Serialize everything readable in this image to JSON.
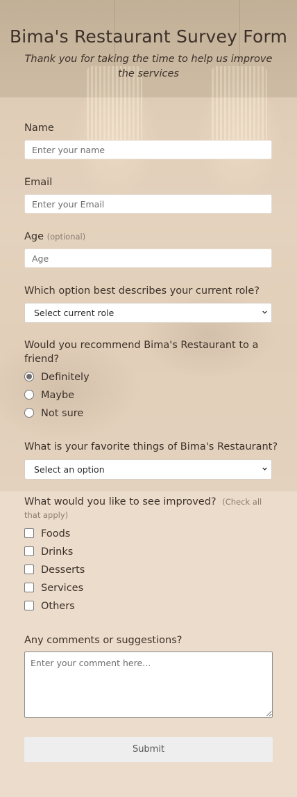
{
  "header": {
    "title": "Bima's Restaurant Survey Form",
    "subtitle": "Thank you for taking the time to help us improve the services"
  },
  "form": {
    "name": {
      "label": "Name",
      "placeholder": "Enter your name"
    },
    "email": {
      "label": "Email",
      "placeholder": "Enter your Email"
    },
    "age": {
      "label": "Age",
      "hint": "(optional)",
      "placeholder": "Age"
    },
    "role": {
      "label": "Which option best describes your current role?",
      "selected": "Select current role"
    },
    "recommend": {
      "label_line1": "Would you recommend Bima's Restaurant to a",
      "label_line2": "friend?",
      "options": [
        "Definitely",
        "Maybe",
        "Not sure"
      ],
      "selected": "Definitely"
    },
    "favorite": {
      "label": "What is your favorite things of Bima's Restaurant?",
      "selected": "Select an option"
    },
    "improve": {
      "label": "What would you like to see improved?",
      "hint_part1": "(Check all",
      "hint_part2": "that apply)",
      "options": [
        "Foods",
        "Drinks",
        "Desserts",
        "Services",
        "Others"
      ]
    },
    "comments": {
      "label": "Any comments or suggestions?",
      "placeholder": "Enter your comment here..."
    },
    "submit_label": "Submit"
  },
  "icons": {
    "select_arrow": "chevron-down-icon"
  },
  "colors": {
    "panel": "#ecdccc",
    "text": "#3b3028",
    "submit_bg": "#eeeeee"
  }
}
